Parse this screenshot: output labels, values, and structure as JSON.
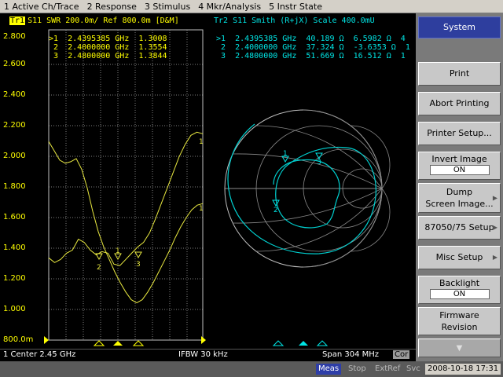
{
  "menu": [
    "1 Active Ch/Trace",
    "2 Response",
    "3 Stimulus",
    "4 Mkr/Analysis",
    "5 Instr State"
  ],
  "trace1": {
    "badge": "Tr1",
    "title": "S11  SWR 200.0m/ Ref 800.0m [D&M]",
    "color": "#ffff00",
    "markers": [
      ">1  2.4395385 GHz  1.3008",
      " 2  2.4000000 GHz  1.3554",
      " 3  2.4800000 GHz  1.3844"
    ]
  },
  "trace2": {
    "title": "Tr2  S11  Smith (R+jX)  Scale 400.0mU",
    "color": "#00e5e5",
    "markers": [
      ">1  2.4395385 GHz  40.189 Ω  6.5982 Ω  4",
      " 2  2.4000000 GHz  37.324 Ω  -3.6353 Ω  1",
      " 3  2.4800000 GHz  51.669 Ω  16.512 Ω  1"
    ]
  },
  "chart_data": {
    "type": "line",
    "yticks": [
      "2.800",
      "2.600",
      "2.400",
      "2.200",
      "2.000",
      "1.800",
      "1.600",
      "1.400",
      "1.200",
      "1.000",
      "800.0m"
    ],
    "ylim": [
      0.8,
      2.8
    ],
    "ref_label": "800.0m",
    "series_yellow": [
      2.08,
      2.02,
      1.96,
      1.94,
      1.95,
      1.97,
      1.9,
      1.78,
      1.63,
      1.5,
      1.4,
      1.32,
      1.24,
      1.17,
      1.11,
      1.06,
      1.04,
      1.06,
      1.11,
      1.17,
      1.24,
      1.31,
      1.38,
      1.46,
      1.53,
      1.59,
      1.64,
      1.67,
      1.68
    ],
    "series_yellow2": [
      1.33,
      1.3,
      1.32,
      1.36,
      1.38,
      1.45,
      1.43,
      1.38,
      1.35,
      1.37,
      1.36,
      1.29,
      1.28,
      1.32,
      1.36,
      1.4,
      1.43,
      1.49,
      1.58,
      1.68,
      1.78,
      1.88,
      1.98,
      2.06,
      2.12,
      2.14,
      2.13
    ],
    "marker_labels": [
      "1",
      "1",
      "2",
      "3"
    ]
  },
  "status": {
    "left": "1  Center 2.45 GHz",
    "center": "IFBW 30 kHz",
    "right": "Span 304 MHz",
    "corr": "Cor"
  },
  "bottom": {
    "meas": "Meas",
    "stop": "Stop",
    "extref": "ExtRef",
    "svc": "Svc",
    "datetime": "2008-10-18 17:31"
  },
  "softkeys": {
    "title": "System",
    "print": "Print",
    "abort": "Abort Printing",
    "printer_setup": "Printer Setup...",
    "invert_image": "Invert Image",
    "invert_value": "ON",
    "dump1": "Dump",
    "dump2": "Screen Image...",
    "setup_8705x": "87050/75 Setup",
    "misc": "Misc Setup",
    "backlight": "Backlight",
    "backlight_value": "ON",
    "firmware1": "Firmware",
    "firmware2": "Revision"
  }
}
